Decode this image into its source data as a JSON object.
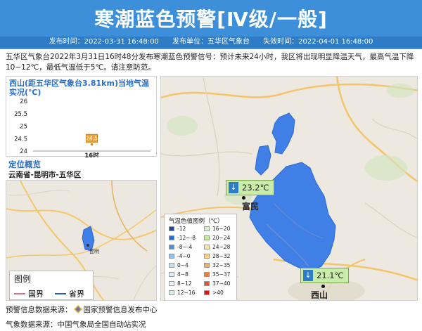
{
  "header": {
    "title": "寒潮蓝色预警[Ⅳ级/一般]",
    "publish_time": "发布时间：2022-03-31 16:48:00",
    "publisher": "发布单位：五华区气象台",
    "expire_time": "失效时间：2022-04-01 16:48:00"
  },
  "description": "五华区气象台2022年3月31日16时48分发布寒潮蓝色预警信号：预计未来24小时，我区将出现明显降温天气，最高气温下降10~12℃，最低气温低于5℃。请注意防范。",
  "colors": {
    "header_bg": "#3d8fd9",
    "meta_bg": "#2e7bc6",
    "warning_area": "#3f7fe6",
    "accent": "#2a6fc9"
  },
  "chart": {
    "title": "西山(距五华区气象台3.81km)当地气温实况(℃)"
  },
  "chart_data": {
    "type": "scatter",
    "x": [
      "16时"
    ],
    "values": [
      24.5
    ],
    "y_ticks": [
      "26",
      "25.5",
      "25",
      "24.5",
      "24"
    ],
    "ylim": [
      24,
      26
    ],
    "data_labels": [
      "24.5"
    ],
    "grid": false
  },
  "location": {
    "title": "定位概览",
    "path": "云南省-昆明市-五华区",
    "minimap_label": "昆明"
  },
  "small_legend": {
    "title": "图例",
    "items": [
      {
        "label": "国界",
        "color": "#d2707a"
      },
      {
        "label": "省界",
        "color": "#2a58c9"
      }
    ]
  },
  "main_map": {
    "stations": [
      {
        "temp": "23.2℃",
        "place": "富民",
        "arrow": "↓"
      },
      {
        "temp": "21.1℃",
        "place": "西山",
        "arrow": "↓"
      }
    ],
    "legend_title": "气温色值图例（℃）",
    "legend": [
      {
        "label": "-12",
        "color": "#2046a8"
      },
      {
        "label": "-12~-8",
        "color": "#2c6ad6"
      },
      {
        "label": "-8~-4",
        "color": "#4b8fe6"
      },
      {
        "label": "-4~0",
        "color": "#8ec2f2"
      },
      {
        "label": "0~4",
        "color": "#bfe0f7"
      },
      {
        "label": "4~8",
        "color": "#d8eef8"
      },
      {
        "label": "8~12",
        "color": "#e9f6fb"
      },
      {
        "label": "12~16",
        "color": "#d6f2e2"
      },
      {
        "label": "16~20",
        "color": "#d9f3c4"
      },
      {
        "label": "20~24",
        "color": "#c6eb8f"
      },
      {
        "label": "24~28",
        "color": "#fbe59a"
      },
      {
        "label": "28~32",
        "color": "#f9d27a"
      },
      {
        "label": "32~35",
        "color": "#f6ad55"
      },
      {
        "label": "35~37",
        "color": "#ef7e3a"
      },
      {
        "label": "37~40",
        "color": "#e2532c"
      },
      {
        "label": ">40",
        "color": "#c81e1e"
      }
    ]
  },
  "footer": {
    "source_label": "预警信息数据来源：",
    "source_value": "国家预警信息发布中心",
    "weather_label": "气象数据来源：",
    "weather_value": "中国气象局全国自动站实况"
  }
}
